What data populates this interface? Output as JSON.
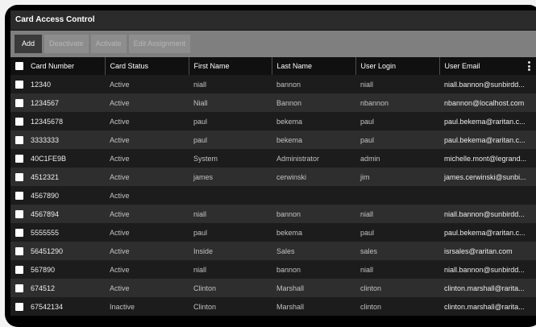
{
  "title": "Card Access Control",
  "toolbar": {
    "add": "Add",
    "deactivate": "Deactivate",
    "activate": "Activate",
    "edit_assignment": "Edit Assignment"
  },
  "columns": [
    "Card Number",
    "Card Status",
    "First Name",
    "Last Name",
    "User Login",
    "User Email"
  ],
  "rows": [
    {
      "card": "12340",
      "status": "Active",
      "first": "niall",
      "last": "bannon",
      "login": "niall",
      "email": "niall.bannon@sunbirdd..."
    },
    {
      "card": "1234567",
      "status": "Active",
      "first": "Niall",
      "last": "Bannon",
      "login": "nbannon",
      "email": "nbannon@localhost.com"
    },
    {
      "card": "12345678",
      "status": "Active",
      "first": "paul",
      "last": "bekema",
      "login": "paul",
      "email": "paul.bekema@raritan.c..."
    },
    {
      "card": "3333333",
      "status": "Active",
      "first": "paul",
      "last": "bekema",
      "login": "paul",
      "email": "paul.bekema@raritan.c..."
    },
    {
      "card": "40C1FE9B",
      "status": "Active",
      "first": "System",
      "last": "Administrator",
      "login": "admin",
      "email": "michelle.mont@legrand..."
    },
    {
      "card": "4512321",
      "status": "Active",
      "first": "james",
      "last": "cerwinski",
      "login": "jim",
      "email": "james.cerwinski@sunbi..."
    },
    {
      "card": "4567890",
      "status": "Active",
      "first": "",
      "last": "",
      "login": "",
      "email": ""
    },
    {
      "card": "4567894",
      "status": "Active",
      "first": "niall",
      "last": "bannon",
      "login": "niall",
      "email": "niall.bannon@sunbirdd..."
    },
    {
      "card": "5555555",
      "status": "Active",
      "first": "paul",
      "last": "bekema",
      "login": "paul",
      "email": "paul.bekema@raritan.c..."
    },
    {
      "card": "56451290",
      "status": "Active",
      "first": "Inside",
      "last": "Sales",
      "login": "sales",
      "email": "isrsales@raritan.com"
    },
    {
      "card": "567890",
      "status": "Active",
      "first": "niall",
      "last": "bannon",
      "login": "niall",
      "email": "niall.bannon@sunbirdd..."
    },
    {
      "card": "674512",
      "status": "Active",
      "first": "Clinton",
      "last": "Marshall",
      "login": "clinton",
      "email": "clinton.marshall@rarita..."
    },
    {
      "card": "67542134",
      "status": "Inactive",
      "first": "Clinton",
      "last": "Marshall",
      "login": "clinton",
      "email": "clinton.marshall@rarita..."
    }
  ]
}
